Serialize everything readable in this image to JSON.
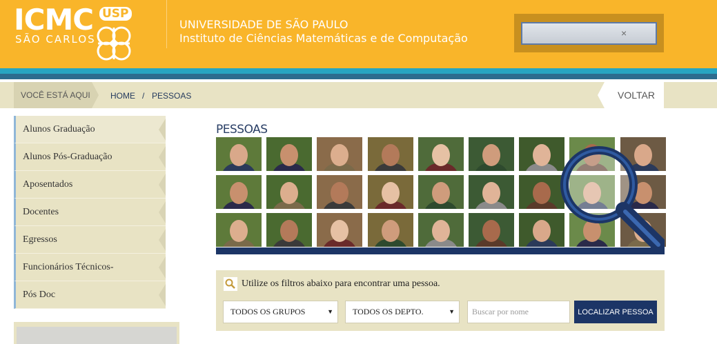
{
  "header": {
    "logo_main": "ICMC",
    "logo_sub": "SÃO CARLOS",
    "logo_badge": "USP",
    "university": "UNIVERSIDADE DE SÃO PAULO",
    "institute": "Instituto de Ciências Matemáticas e de Computação",
    "search_clear": "×",
    "colors": {
      "accent": "#f9b52a",
      "stripe_blue": "#27a5c1",
      "stripe_navy": "#2c6c8e"
    }
  },
  "breadcrumb": {
    "label": "VOCÊ ESTÁ AQUI",
    "home": "HOME",
    "separator": "/",
    "current": "PESSOAS",
    "back": "VOLTAR"
  },
  "sidebar": {
    "items": [
      {
        "label": "Alunos Graduação"
      },
      {
        "label": "Alunos Pós-Graduação"
      },
      {
        "label": "Aposentados"
      },
      {
        "label": "Docentes"
      },
      {
        "label": "Egressos"
      },
      {
        "label": "Funcionários Técnicos-"
      },
      {
        "label": "Pós Doc"
      }
    ]
  },
  "main": {
    "title": "PESSOAS",
    "filter_intro": "Utilize os filtros abaixo para encontrar uma pessoa.",
    "group_select": "TODOS OS GRUPOS",
    "dept_select": "TODOS OS DEPTO.",
    "name_placeholder": "Buscar por nome",
    "submit": "LOCALIZAR PESSOA",
    "select_arrow": "▼"
  }
}
